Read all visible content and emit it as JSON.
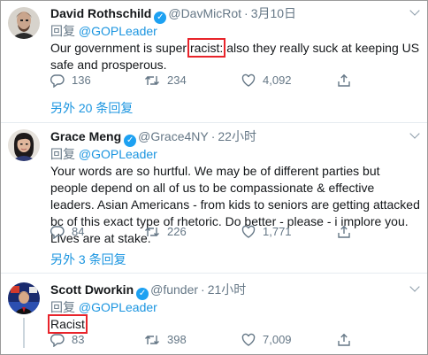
{
  "tweets": [
    {
      "name": "David Rothschild",
      "handle": "@DavMicRot",
      "time": "3月10日",
      "reply_label": "回复",
      "reply_to": "@GOPLeader",
      "text_before": "Our government is super ",
      "text_highlight": "racist:",
      "text_after": " also they really suck at keeping US safe and prosperous.",
      "counts": {
        "reply": "136",
        "retweet": "234",
        "like": "4,092"
      },
      "more_replies": "另外 20 条回复"
    },
    {
      "name": "Grace Meng",
      "handle": "@Grace4NY",
      "time": "22小时",
      "reply_label": "回复",
      "reply_to": "@GOPLeader",
      "text": "Your words are so hurtful. We may be of different parties but people depend on all of us to be compassionate & effective leaders. Asian Americans - from kids to seniors are getting attacked bc of this exact type of rhetoric. Do better - please - i implore you. Lives are at stake.",
      "counts": {
        "reply": "84",
        "retweet": "226",
        "like": "1,771"
      },
      "more_replies": "另外 3 条回复"
    },
    {
      "name": "Scott Dworkin",
      "handle": "@funder",
      "time": "21小时",
      "reply_label": "回复",
      "reply_to": "@GOPLeader",
      "text_highlight": "Racist",
      "counts": {
        "reply": "83",
        "retweet": "398",
        "like": "7,009"
      }
    }
  ],
  "separator": "·",
  "icons": {
    "reply": "reply-icon",
    "retweet": "retweet-icon",
    "like": "like-icon",
    "share": "share-icon",
    "verified": "verified-badge-icon",
    "menu": "chevron-down-icon"
  },
  "colors": {
    "link": "#1b95e0",
    "muted": "#657786",
    "verified": "#1da1f2",
    "highlight_box": "#e8242b"
  }
}
